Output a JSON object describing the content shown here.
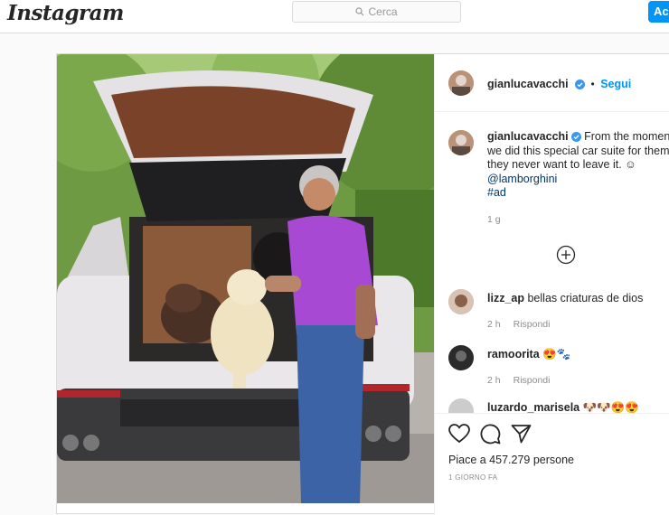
{
  "header": {
    "logo": "Instagram",
    "search_placeholder": "Cerca",
    "login_label": "Ac"
  },
  "post": {
    "author": "gianlucavacchi",
    "follow_label": "Segui",
    "separator": "•",
    "caption": {
      "author": "gianlucavacchi",
      "text": "From the moment we did this special car suite for them, they never want to leave it. ☺",
      "mention": "@lamborghini",
      "hashtag": "#ad",
      "time": "1 g"
    },
    "comments": [
      {
        "user": "lizz_ap",
        "text": "bellas criaturas de dios",
        "time": "2 h",
        "reply": "Rispondi"
      },
      {
        "user": "ramoorita",
        "text": "😍🐾",
        "time": "2 h",
        "reply": "Rispondi"
      },
      {
        "user": "luzardo_marisela",
        "text": "🐶🐶😍😍"
      }
    ],
    "likes": "Piace a 457.279 persone",
    "date": "1 GIORNO FA"
  },
  "colors": {
    "accent": "#0095f6",
    "mention": "#00376b",
    "muted": "#8e8e8e"
  },
  "icons": [
    "search-icon",
    "verified-icon",
    "add-comment-icon",
    "heart-icon",
    "comment-icon",
    "share-icon"
  ]
}
